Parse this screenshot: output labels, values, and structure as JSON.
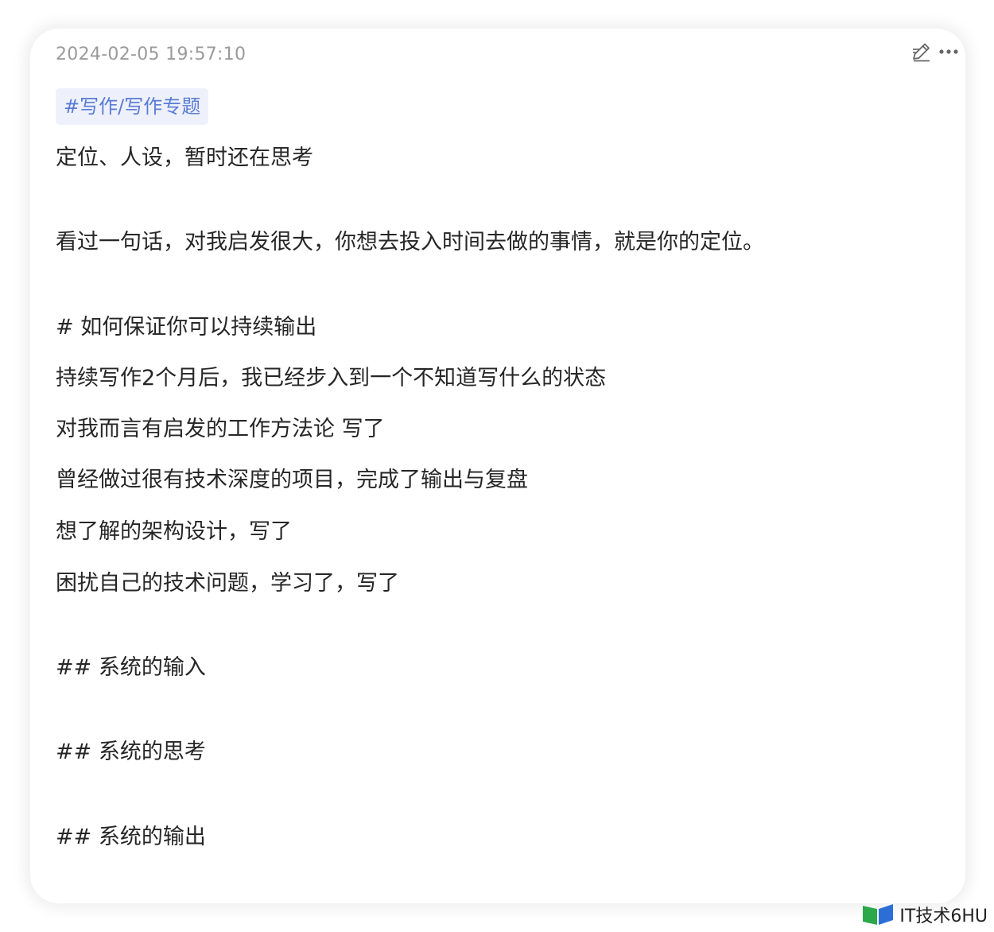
{
  "note": {
    "timestamp": "2024-02-05 19:57:10",
    "tag": "#写作/写作专题",
    "lines": [
      "定位、人设，暂时还在思考",
      "看过一句话，对我启发很大，你想去投入时间去做的事情，就是你的定位。",
      "# 如何保证你可以持续输出",
      "持续写作2个月后，我已经步入到一个不知道写什么的状态",
      "对我而言有启发的工作方法论 写了",
      "曾经做过很有技术深度的项目，完成了输出与复盘",
      "想了解的架构设计，写了",
      "困扰自己的技术问题，学习了，写了",
      "## 系统的输入",
      "## 系统的思考",
      "## 系统的输出"
    ]
  },
  "toolbar": {
    "edit_icon": "edit-pencil-icon",
    "more_icon": "more-dots-icon"
  },
  "watermark": {
    "text": "IT技术6HU"
  },
  "colors": {
    "tag_text": "#5a7bd6",
    "tag_bg": "#eef1fb",
    "timestamp": "#9a9a9a",
    "body_text": "#262626"
  }
}
